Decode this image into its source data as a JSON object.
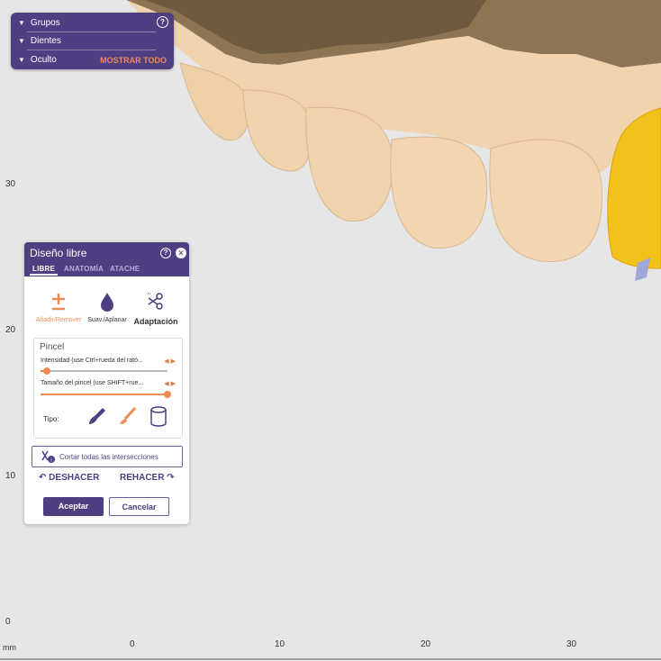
{
  "colors": {
    "accent_purple": "#4e3f83",
    "accent_orange": "#f08a55",
    "tooth_beige": "#f1d3ad",
    "crown_yellow": "#f2c21b",
    "background": "#e6e6e6"
  },
  "viewport": {
    "left_ruler_labels": [
      "30",
      "20",
      "10",
      "0"
    ],
    "bottom_ruler_labels": [
      "0",
      "10",
      "20",
      "30"
    ],
    "unit_label": "mm"
  },
  "top_panel": {
    "rows": [
      {
        "label": "Grupos"
      },
      {
        "label": "Dientes"
      },
      {
        "label": "Oculto"
      }
    ],
    "show_all": "MOSTRAR TODO"
  },
  "panel": {
    "title": "Diseño libre",
    "tabs": [
      "LIBRE",
      "ANATOMÍA",
      "ATACHE"
    ],
    "active_tab": "LIBRE",
    "tools": [
      {
        "label": "Añadir/Remover",
        "icon": "plus-minus-icon"
      },
      {
        "label": "Suav./Aplanar",
        "icon": "drop-icon"
      },
      {
        "label": "Adaptación",
        "icon": "scissors-icon"
      }
    ],
    "pincel": {
      "title": "Pincel",
      "intensity_label": "Intensidad (use Ctrl+rueda del rató...",
      "intensity_value": 0.05,
      "size_label": "Tamaño del pincel (use SHIFT+rue...",
      "size_value": 1.0,
      "tipo_label": "Tipo:",
      "types": [
        "brush-icon",
        "paintbrush-icon",
        "cylinder-icon"
      ]
    },
    "cut_all": "Cortar todas las intersecciones",
    "undo": "DESHACER",
    "redo": "REHACER",
    "accept": "Aceptar",
    "cancel": "Cancelar"
  }
}
